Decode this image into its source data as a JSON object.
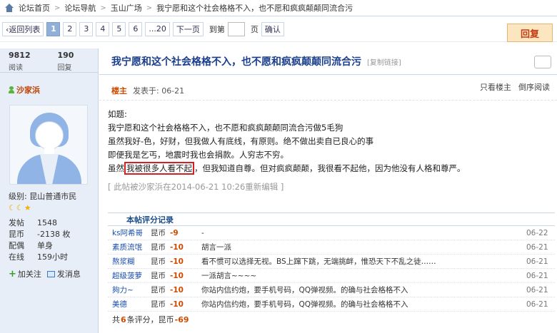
{
  "breadcrumb": [
    "论坛首页",
    "论坛导航",
    "玉山广场",
    "我宁愿和这个社会格格不入，也不愿和疯疯颠颠同流合污"
  ],
  "pager": {
    "back": "‹返回列表",
    "pages": [
      "1",
      "2",
      "3",
      "4",
      "5",
      "6",
      "...20"
    ],
    "next": "下一页",
    "goto": "到第",
    "page_unit": "页",
    "confirm": "确认"
  },
  "reply_button": "回复",
  "stats": {
    "views": "9812",
    "views_label": "阅读",
    "replies": "190",
    "replies_label": "回复"
  },
  "user": {
    "name": "沙家浜",
    "level": "级别: 昆山普通市民",
    "stars": "☾☾★",
    "profile": [
      {
        "key": "发帖",
        "value": "1548"
      },
      {
        "key": "昆币",
        "value": "-2138 枚"
      },
      {
        "key": "配偶",
        "value": "单身"
      },
      {
        "key": "在线",
        "value": "159小时"
      }
    ],
    "follow": "加关注",
    "message": "发消息"
  },
  "post": {
    "title": "我宁愿和这个社会格格不入，也不愿和疯疯颠颠同流合污",
    "copy_link": "[复制链接]",
    "author_tag": "楼主",
    "posted": "发表于: 06-21",
    "only_op": "只看楼主",
    "reverse": "倒序阅读",
    "lines": [
      "如题:",
      "我宁愿和这个社会格格不入，也不愿和疯疯颠颠同流合污做5毛狗",
      "虽然我好-色，好财，但我做人有底线，有原则。绝不做出卖自已良心的事",
      "即便我是乞丐，地震时我也会捐款。人穷志不穷。"
    ],
    "last_line_pre": "虽然",
    "last_line_hl": "我被很多人看不起",
    "last_line_post": "，但我知道自尊。但对疯疯颠颠，我很看不起他，因为他没有人格和尊严。",
    "edit_note": "[ 此帖被沙家浜在2014-06-21 10:26重新编辑 ]"
  },
  "rating": {
    "title": "本帖评分记录",
    "rows": [
      {
        "user": "ks阿希哥",
        "currency": "昆币",
        "value": "-9",
        "reason": "-",
        "date": "06-22"
      },
      {
        "user": "素质流氓",
        "currency": "昆币",
        "value": "-10",
        "reason": "胡言一派",
        "date": "06-21"
      },
      {
        "user": "熬浆糊",
        "currency": "昆币",
        "value": "-10",
        "reason": "看不惯可以选择无视。BS上蹿下跳，无端挑衅，惟恐天下不乱之徒……",
        "date": "06-21"
      },
      {
        "user": "超级菠萝",
        "currency": "昆币",
        "value": "-10",
        "reason": "一派胡言~~~~",
        "date": "06-21"
      },
      {
        "user": "夠力~",
        "currency": "昆币",
        "value": "-10",
        "reason": "你站内信约炮，要手机号码，QQ弹视频。的确与社会格格不入",
        "date": "06-21"
      },
      {
        "user": "美德",
        "currency": "昆币",
        "value": "-10",
        "reason": "你站内信约炮，要手机号码，QQ弹视频。的确与社会格格不入",
        "date": "06-21"
      }
    ],
    "sum_pre": "共",
    "sum_count": "6",
    "sum_mid": "条评分，昆币",
    "sum_value": "-69"
  }
}
